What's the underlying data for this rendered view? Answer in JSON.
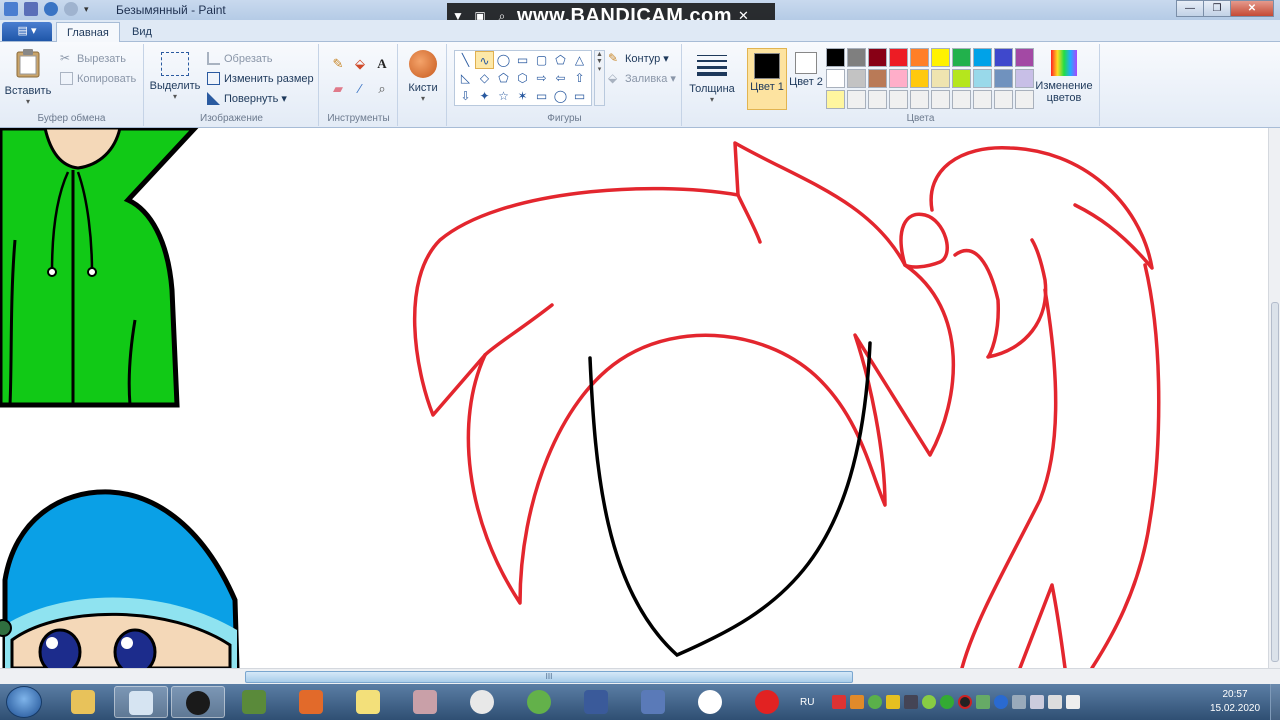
{
  "window": {
    "title": "Безымянный - Paint",
    "controls": [
      "—",
      "❐",
      "✕"
    ]
  },
  "overlay": {
    "watermark": "www.BANDICAM.com"
  },
  "tabs": {
    "file_glyph": "▤ ▾",
    "home": "Главная",
    "view": "Вид"
  },
  "clipboard": {
    "paste": "Вставить",
    "cut": "Вырезать",
    "copy": "Копировать",
    "label": "Буфер обмена"
  },
  "image": {
    "select": "Выделить",
    "crop": "Обрезать",
    "resize": "Изменить размер",
    "rotate": "Повернуть ▾",
    "label": "Изображение"
  },
  "tools": {
    "label": "Инструменты",
    "text_glyph": "A"
  },
  "brushes": {
    "label": "Кисти"
  },
  "shapes": {
    "label": "Фигуры",
    "outline": "Контур ▾",
    "fill": "Заливка ▾",
    "glyphs": [
      "╲",
      "∿",
      "◯",
      "▭",
      "▢",
      "⬠",
      "△",
      "◺",
      "◇",
      "⬠",
      "⬡",
      "⇨",
      "⇦",
      "⇧",
      "⇩",
      "✦",
      "☆",
      "✶",
      "▭",
      "◯",
      "▭"
    ]
  },
  "size": {
    "label": "Толщина"
  },
  "colors": {
    "color1_label": "Цвет 1",
    "color2_label": "Цвет 2",
    "edit": "Изменение цветов",
    "label": "Цвета",
    "color1": "#000000",
    "color2": "#ffffff",
    "palette": [
      "#000000",
      "#7f7f7f",
      "#880015",
      "#ed1c24",
      "#ff7f27",
      "#fff200",
      "#22b14c",
      "#00a2e8",
      "#3f48cc",
      "#a349a4",
      "#ffffff",
      "#c3c3c3",
      "#b97a57",
      "#ffaec9",
      "#ffc90e",
      "#efe4b0",
      "#b5e61d",
      "#99d9ea",
      "#7092be",
      "#c8bfe7",
      "#fff69f",
      "#f0f0f0",
      "#f0f0f0",
      "#f0f0f0",
      "#f0f0f0",
      "#f0f0f0",
      "#f0f0f0",
      "#f0f0f0",
      "#f0f0f0",
      "#f0f0f0"
    ]
  },
  "canvas": {
    "stroke_red": "#e3262e",
    "stroke_black": "#000000",
    "hoodie_green": "#11c916",
    "hat_blue": "#0aa0e6"
  },
  "hscroll_grip": "III",
  "taskbar": {
    "lang": "RU",
    "time": "20:57",
    "date": "15.02.2020",
    "apps": [
      "explorer",
      "paint",
      "bandicam",
      "minecraft",
      "media-player",
      "stickies",
      "winrar",
      "chrome",
      "utorrent",
      "drawing-app",
      "network-app",
      "yandex-browser",
      "opera"
    ]
  }
}
